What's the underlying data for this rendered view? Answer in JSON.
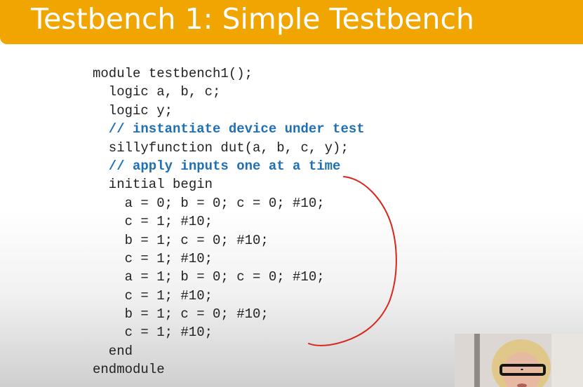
{
  "slide": {
    "title": "Testbench 1: Simple Testbench",
    "accent_color": "#f0a500",
    "comment_color": "#1f6fb5",
    "annotation_color": "#d9261c"
  },
  "code_lines": [
    {
      "text": "module testbench1();",
      "indent": 0,
      "comment": false
    },
    {
      "text": "logic a, b, c;",
      "indent": 2,
      "comment": false
    },
    {
      "text": "logic y;",
      "indent": 2,
      "comment": false
    },
    {
      "text": "// instantiate device under test",
      "indent": 2,
      "comment": true
    },
    {
      "text": "sillyfunction dut(a, b, c, y);",
      "indent": 2,
      "comment": false
    },
    {
      "text": "// apply inputs one at a time",
      "indent": 2,
      "comment": true
    },
    {
      "text": "initial begin",
      "indent": 2,
      "comment": false
    },
    {
      "text": "a = 0; b = 0; c = 0; #10;",
      "indent": 4,
      "comment": false
    },
    {
      "text": "c = 1; #10;",
      "indent": 4,
      "comment": false
    },
    {
      "text": "b = 1; c = 0; #10;",
      "indent": 4,
      "comment": false
    },
    {
      "text": "c = 1; #10;",
      "indent": 4,
      "comment": false
    },
    {
      "text": "a = 1; b = 0; c = 0; #10;",
      "indent": 4,
      "comment": false
    },
    {
      "text": "c = 1; #10;",
      "indent": 4,
      "comment": false
    },
    {
      "text": "b = 1; c = 0; #10;",
      "indent": 4,
      "comment": false
    },
    {
      "text": "c = 1; #10;",
      "indent": 4,
      "comment": false
    },
    {
      "text": "end",
      "indent": 2,
      "comment": false
    },
    {
      "text": "endmodule",
      "indent": 0,
      "comment": false
    }
  ]
}
